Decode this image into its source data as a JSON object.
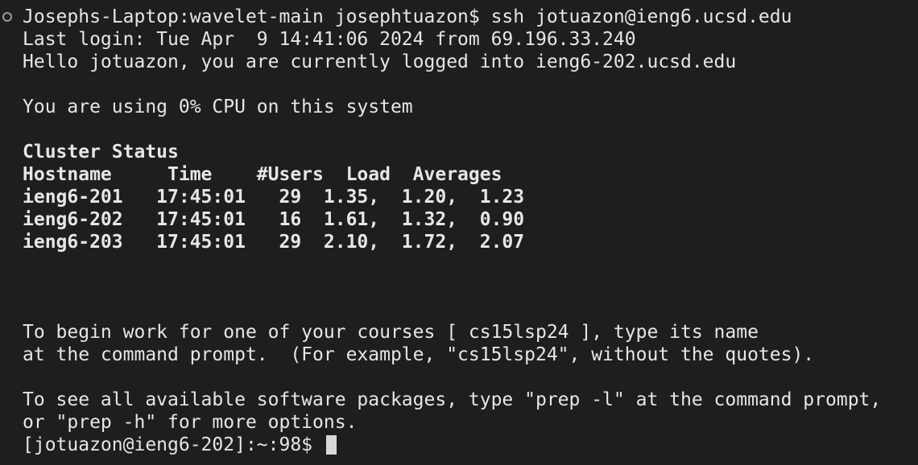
{
  "terminal": {
    "command_line": "Josephs-Laptop:wavelet-main josephtuazon$ ssh jotuazon@ieng6.ucsd.edu",
    "last_login": "Last login: Tue Apr  9 14:41:06 2024 from 69.196.33.240",
    "hello": "Hello jotuazon, you are currently logged into ieng6-202.ucsd.edu",
    "cpu_usage": "You are using 0% CPU on this system",
    "cluster": {
      "title": "Cluster Status",
      "header": "Hostname     Time    #Users  Load  Averages",
      "rows": [
        {
          "text": "ieng6-201   17:45:01   29  1.35,  1.20,  1.23"
        },
        {
          "text": "ieng6-202   17:45:01   16  1.61,  1.32,  0.90"
        },
        {
          "text": "ieng6-203   17:45:01   29  2.10,  1.72,  2.07"
        }
      ]
    },
    "course_line_1": "To begin work for one of your courses [ cs15lsp24 ], type its name",
    "course_line_2": "at the command prompt.  (For example, \"cs15lsp24\", without the quotes).",
    "prep_line_1": "To see all available software packages, type \"prep -l\" at the command prompt,",
    "prep_line_2": "or \"prep -h\" for more options.",
    "prompt": "[jotuazon@ieng6-202]:~:98$"
  }
}
